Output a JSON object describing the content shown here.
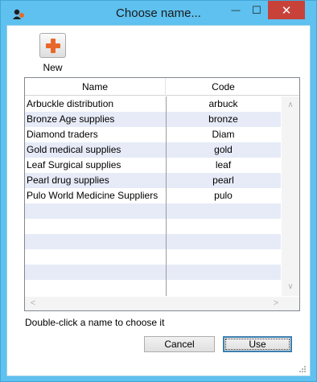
{
  "window": {
    "title": "Choose name...",
    "minimize_glyph": "—",
    "maximize_glyph": "☐",
    "close_glyph": "✕"
  },
  "toolbar": {
    "new_label": "New",
    "new_icon": "plus-icon"
  },
  "table": {
    "columns": [
      "Name",
      "Code"
    ],
    "rows": [
      {
        "name": "Arbuckle distribution",
        "code": "arbuck"
      },
      {
        "name": "Bronze Age supplies",
        "code": "bronze"
      },
      {
        "name": "Diamond traders",
        "code": "Diam"
      },
      {
        "name": "Gold medical supplies",
        "code": "gold"
      },
      {
        "name": "Leaf Surgical supplies",
        "code": "leaf"
      },
      {
        "name": "Pearl drug supplies",
        "code": "pearl"
      },
      {
        "name": "Pulo World Medicine Suppliers",
        "code": "pulo"
      }
    ],
    "scroll_up_glyph": "∧",
    "scroll_down_glyph": "∨",
    "scroll_left_glyph": "<",
    "scroll_right_glyph": ">"
  },
  "footer": {
    "hint": "Double-click a name to choose it",
    "cancel_label": "Cancel",
    "use_label": "Use"
  },
  "colors": {
    "titlebar": "#5ec1ef",
    "close_button": "#c9423a",
    "row_stripe": "#e6ebf7",
    "accent_plus": "#e8682a"
  }
}
